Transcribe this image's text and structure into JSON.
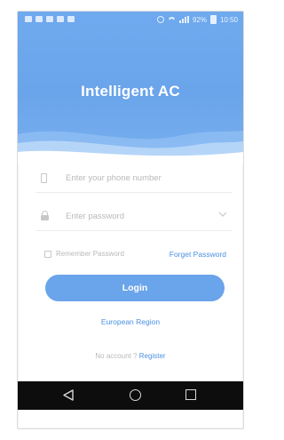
{
  "status_bar": {
    "battery": "92%",
    "time": "10:50",
    "left_icons": [
      "gallery-icon",
      "notification-icon",
      "notification-icon",
      "message-icon",
      "app-icon"
    ],
    "right_icons": [
      "alarm-icon",
      "wifi-icon",
      "signal-icon",
      "battery-icon"
    ]
  },
  "header": {
    "title": "Intelligent AC"
  },
  "form": {
    "phone_placeholder": "Enter your phone number",
    "password_placeholder": "Enter password",
    "remember_label": "Remember Password",
    "forget_label": "Forget Password",
    "login_label": "Login",
    "region_label": "European Region",
    "no_account_text": "No account ?",
    "register_label": "Register"
  },
  "nav": {
    "icons": [
      "back-icon",
      "home-icon",
      "recent-apps-icon"
    ]
  },
  "colors": {
    "accent": "#6aa4ea",
    "link": "#4a90e2",
    "nav_bg": "#0d0d0d"
  }
}
